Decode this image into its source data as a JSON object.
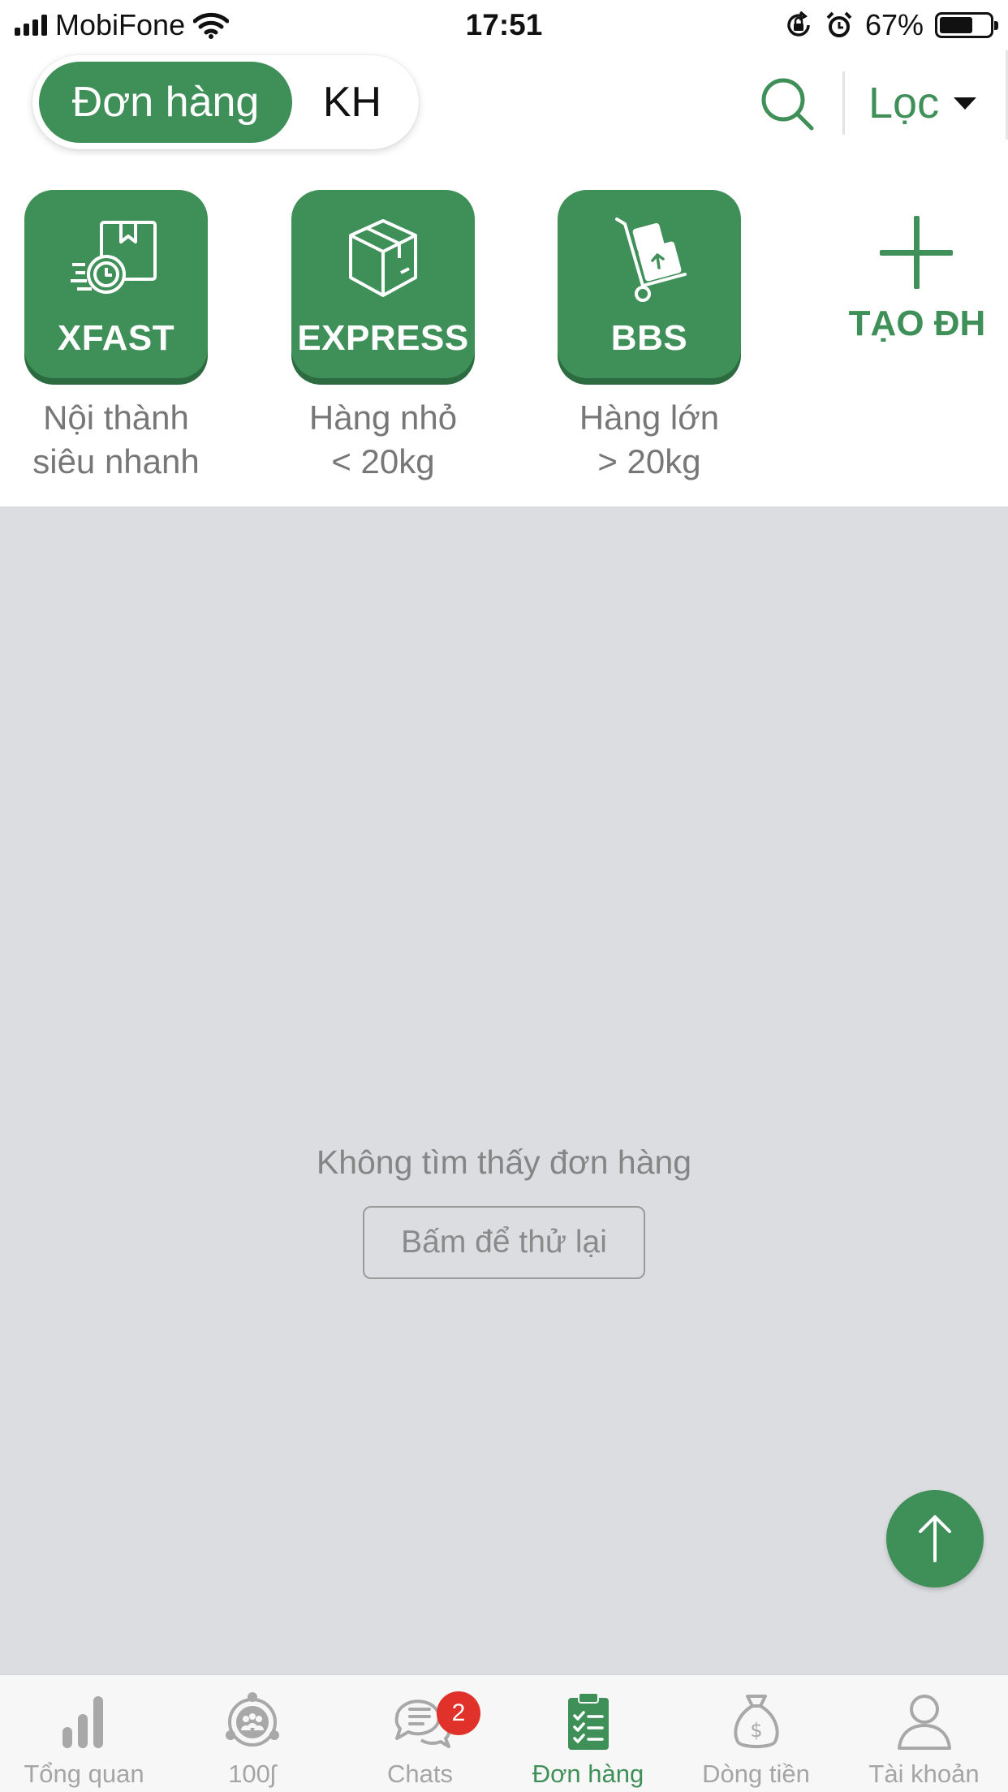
{
  "status_bar": {
    "carrier": "MobiFone",
    "time": "17:51",
    "battery_percent": "67%",
    "battery_level": 0.67
  },
  "header": {
    "segments": [
      {
        "label": "Đơn hàng",
        "active": true
      },
      {
        "label": "KH",
        "active": false
      }
    ],
    "search_icon": "search-icon",
    "filter_label": "Lọc"
  },
  "services": [
    {
      "name": "XFAST",
      "desc": "Nội thành\nsiêu nhanh",
      "icon": "fast-delivery-box-icon"
    },
    {
      "name": "EXPRESS",
      "desc": "Hàng nhỏ\n< 20kg",
      "icon": "package-box-icon"
    },
    {
      "name": "BBS",
      "desc": "Hàng lớn\n> 20kg",
      "icon": "hand-truck-icon"
    }
  ],
  "create_order": {
    "label": "TẠO ĐH",
    "icon": "plus-icon"
  },
  "empty_state": {
    "message": "Không tìm thấy đơn hàng",
    "retry_label": "Bấm để thử lại"
  },
  "fab": {
    "icon": "arrow-up-icon"
  },
  "tabbar": {
    "tabs": [
      {
        "label": "Tổng quan",
        "icon": "bar-chart-icon",
        "active": false
      },
      {
        "label": "100ʃ",
        "icon": "community-icon",
        "active": false
      },
      {
        "label": "Chats",
        "icon": "chat-bubbles-icon",
        "active": false,
        "badge": "2"
      },
      {
        "label": "Đơn hàng",
        "icon": "clipboard-checklist-icon",
        "active": true
      },
      {
        "label": "Dòng tiền",
        "icon": "money-bag-icon",
        "active": false
      },
      {
        "label": "Tài khoản",
        "icon": "user-icon",
        "active": false
      }
    ]
  },
  "colors": {
    "brand_green": "#3f8f58",
    "content_bg": "#dcdde0",
    "badge_red": "#e0322b"
  }
}
